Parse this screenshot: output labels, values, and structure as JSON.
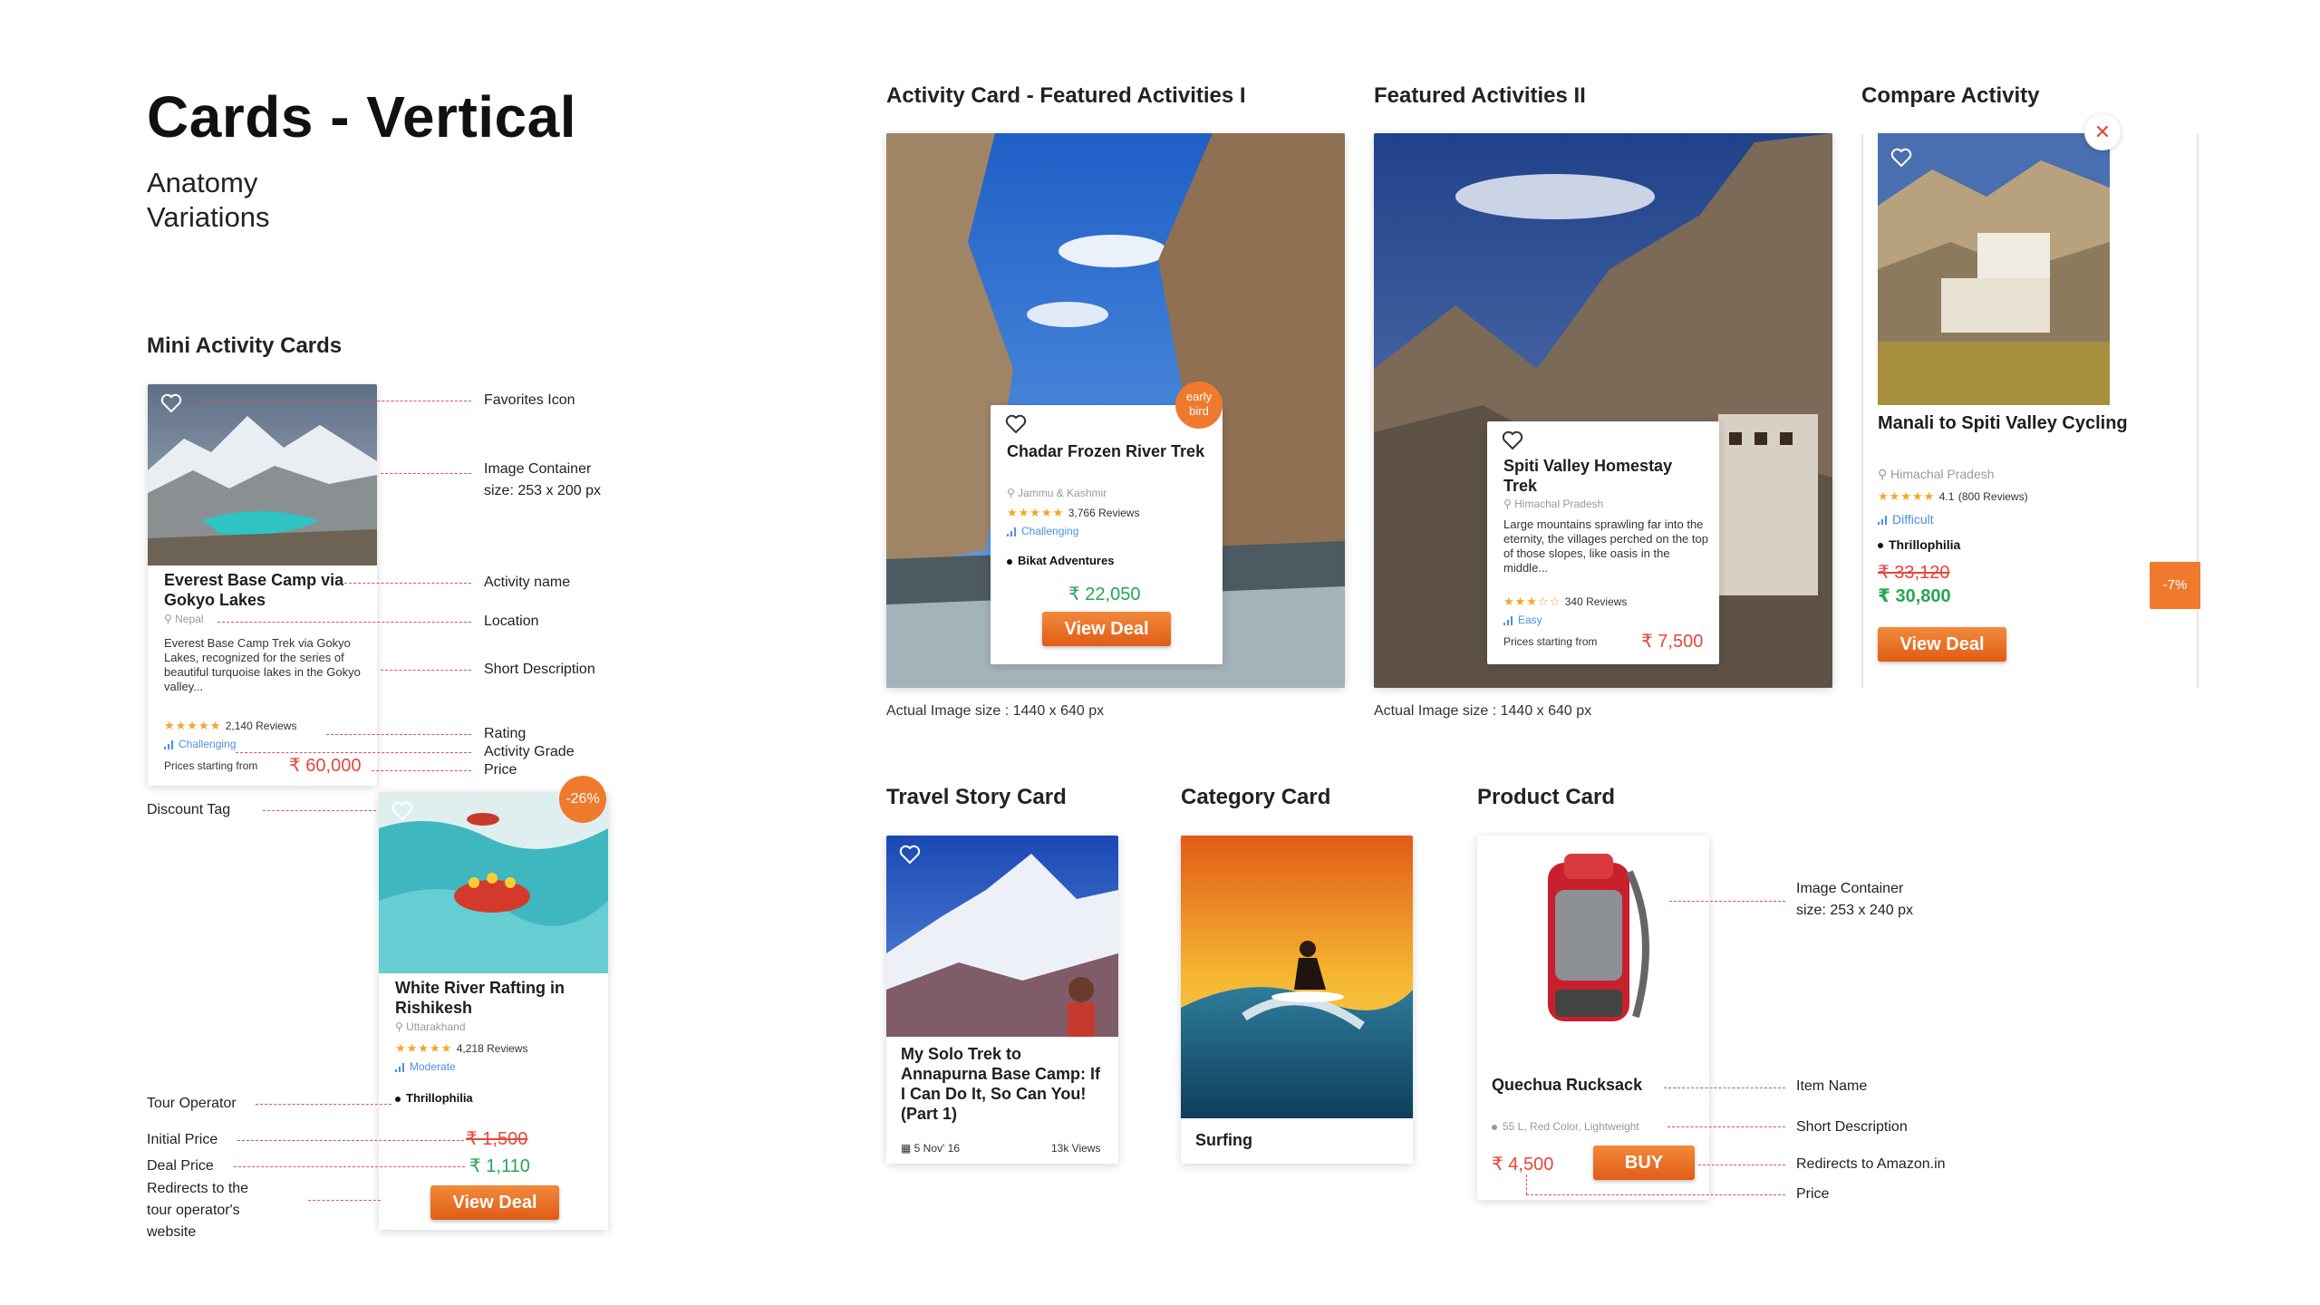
{
  "header": {
    "title": "Cards - Vertical",
    "subtitle_line1": "Anatomy",
    "subtitle_line2": "Variations"
  },
  "sections": {
    "mini": "Mini Activity Cards",
    "featured1": "Activity Card - Featured Activities I",
    "featured2": "Featured Activities II",
    "compare": "Compare Activity",
    "travel_story": "Travel Story Card",
    "category": "Category Card",
    "product": "Product Card"
  },
  "mini_card_1": {
    "title": "Everest Base Camp via Gokyo Lakes",
    "location": "Nepal",
    "description": "Everest Base Camp Trek via Gokyo Lakes, recognized for the series of beautiful turquoise lakes in the Gokyo valley...",
    "stars": "★★★★★",
    "reviews": "2,140 Reviews",
    "grade": "Challenging",
    "price_label": "Prices starting from",
    "price": "₹ 60,000"
  },
  "mini_card_2": {
    "discount": "-26%",
    "title": "White River Rafting in Rishikesh",
    "location": "Uttarakhand",
    "stars": "★★★★★",
    "reviews": "4,218 Reviews",
    "grade": "Moderate",
    "operator": "Thrillophilia",
    "initial_price": "₹ 1,500",
    "deal_price": "₹ 1,110",
    "button": "View Deal"
  },
  "mini_annotations": {
    "favorites": "Favorites Icon",
    "image_container_1": "Image Container",
    "image_container_2": "size: 253 x 200 px",
    "activity_name": "Activity name",
    "location": "Location",
    "short_desc": "Short Description",
    "rating": "Rating",
    "grade": "Activity Grade",
    "price": "Price",
    "discount_tag": "Discount Tag",
    "tour_operator": "Tour Operator",
    "initial_price": "Initial Price",
    "deal_price": "Deal Price",
    "redirects_1": "Redirects to the",
    "redirects_2": "tour operator's",
    "redirects_3": "website"
  },
  "featured1": {
    "badge_line1": "early",
    "badge_line2": "bird",
    "title": "Chadar Frozen River Trek",
    "location": "Jammu & Kashmir",
    "stars": "★★★★★",
    "reviews": "3,766 Reviews",
    "grade": "Challenging",
    "operator": "Bikat Adventures",
    "price": "₹ 22,050",
    "button": "View Deal",
    "caption": "Actual Image size : 1440 x 640 px"
  },
  "featured2": {
    "title": "Spiti Valley Homestay Trek",
    "location": "Himachal Pradesh",
    "description": "Large mountains sprawling far into the eternity, the villages perched on the top of those slopes, like oasis in the middle...",
    "stars": "★★★☆☆",
    "reviews": "340 Reviews",
    "grade": "Easy",
    "price_label": "Prices starting from",
    "price": "₹ 7,500",
    "caption": "Actual Image size : 1440 x 640 px"
  },
  "compare": {
    "title": "Manali to Spiti Valley Cycling",
    "location": "Himachal Pradesh",
    "stars": "★★★★★",
    "rating": "4.1",
    "reviews": "(800 Reviews)",
    "grade": "Difficult",
    "operator": "Thrillophilia",
    "initial_price": "₹ 33,120",
    "deal_price": "₹ 30,800",
    "button": "View Deal",
    "discount": "-7%"
  },
  "travel_story": {
    "title": "My Solo Trek to Annapurna Base Camp: If I Can Do It, So Can You! (Part 1)",
    "date": "5 Nov' 16",
    "views": "13k Views"
  },
  "category": {
    "label": "Surfing"
  },
  "product": {
    "name": "Quechua Rucksack",
    "description": "55 L, Red Color, Lightweight",
    "price": "₹ 4,500",
    "button": "BUY"
  },
  "product_annotations": {
    "image_container_1": "Image Container",
    "image_container_2": "size: 253 x 240 px",
    "item_name": "Item Name",
    "short_desc": "Short Description",
    "redirects": "Redirects to Amazon.in",
    "price": "Price"
  }
}
